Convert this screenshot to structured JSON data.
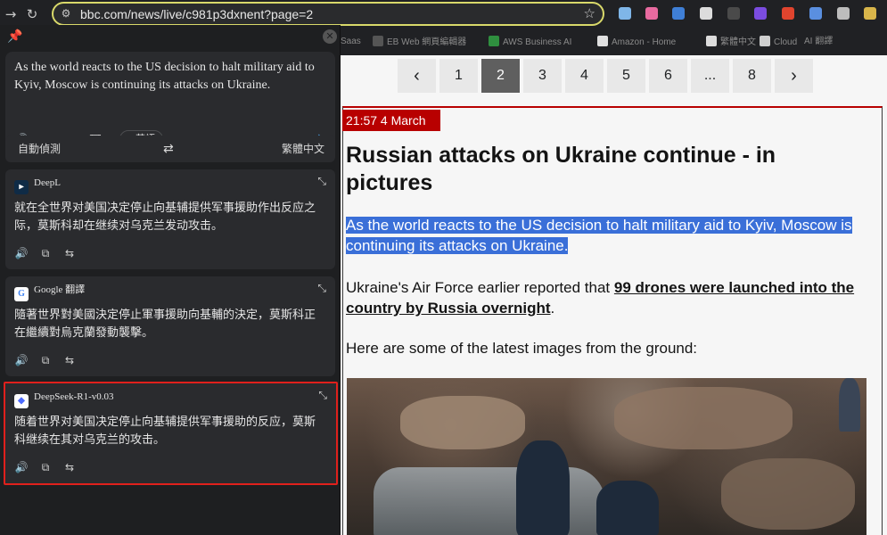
{
  "browser": {
    "url": "bbc.com/news/live/c981p3dxnent?page=2",
    "bookmarks": [
      "Saas",
      "EB Web 網頁編輯器",
      "AWS Business AI",
      "Amazon - Home",
      "繁體中文",
      "Cloud",
      "AI 翻譯"
    ]
  },
  "translator": {
    "source_text": "As the world reacts to the US decision to halt military aid to Kyiv, Moscow is continuing its attacks on Ukraine.",
    "detected_lang": "英語",
    "from_lang": "自動偵測",
    "to_lang": "繁體中文",
    "cards": [
      {
        "name": "DeepL",
        "text": "就在全世界对美国决定停止向基辅提供军事援助作出反应之际，莫斯科却在继续对乌克兰发动攻击。"
      },
      {
        "name": "Google 翻譯",
        "text": "隨著世界對美國決定停止軍事援助向基輔的決定，莫斯科正在繼續對烏克蘭發動襲擊。"
      },
      {
        "name": "DeepSeek-R1-v0.03",
        "text": "随着世界对美国决定停止向基辅提供军事援助的反应，莫斯科继续在其对乌克兰的攻击。"
      }
    ]
  },
  "pagination": {
    "prev": "‹",
    "pages": [
      "1",
      "2",
      "3",
      "4",
      "5",
      "6",
      "...",
      "8"
    ],
    "current": "2",
    "next": "›"
  },
  "article": {
    "timestamp": "21:57 4 March",
    "headline": "Russian attacks on Ukraine continue - in pictures",
    "lead": "As the world reacts to the US decision to halt military aid to Kyiv, Moscow is continuing its attacks on Ukraine.",
    "p2_before": "Ukraine's Air Force earlier reported that ",
    "p2_link": "99 drones were launched into the country by Russia overnight",
    "p2_after": ".",
    "p3": "Here are some of the latest images from the ground:"
  }
}
